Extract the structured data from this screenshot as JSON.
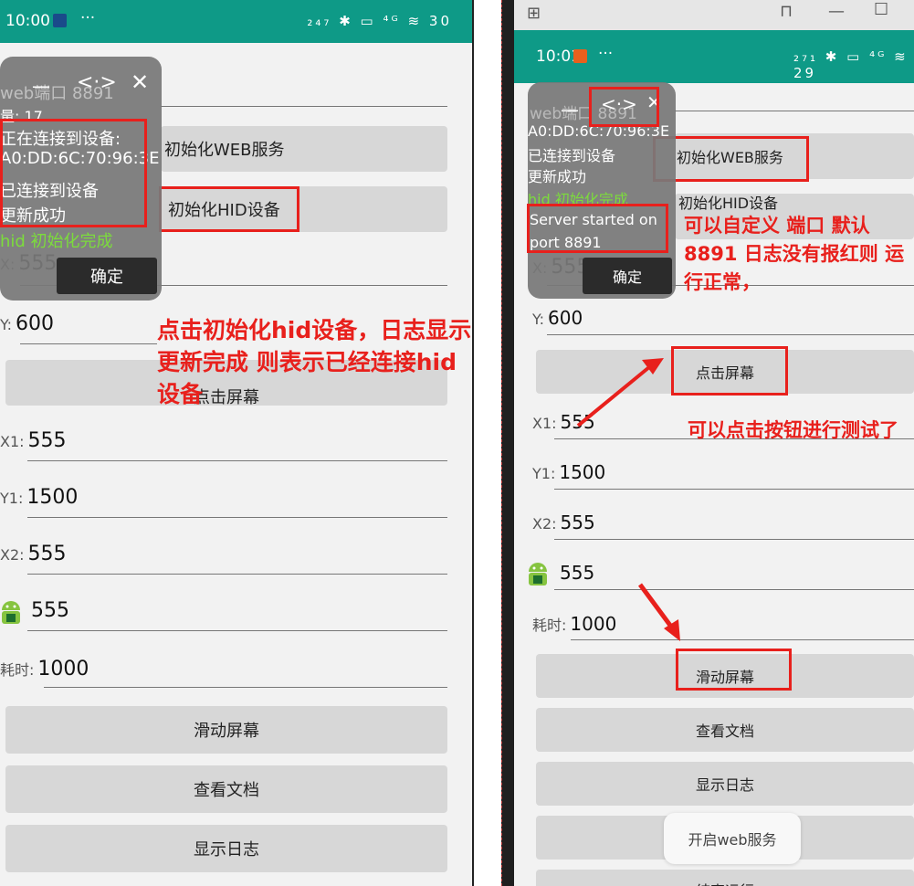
{
  "left": {
    "status": {
      "time": "10:00",
      "icons": "₂₄₇ ✱ ▭ ⁴ᴳ ≋ 30"
    },
    "overlay": {
      "titlebar": {
        "minimize": "—",
        "code": "<·>",
        "close": "✕"
      },
      "lines": [
        "web端口 8891",
        "量: 17",
        "正在连接到设备:",
        "A0:DD:6C:70:96:3E",
        "已连接到设备",
        "更新成功",
        "hid 初始化完成"
      ],
      "ok_label": "确定"
    },
    "fields": {
      "x": {
        "label": "X:",
        "value": "555"
      },
      "y": {
        "label": "Y:",
        "value": "600"
      },
      "x1": {
        "label": "X1:",
        "value": "555"
      },
      "y1": {
        "label": "Y1:",
        "value": "1500"
      },
      "x2": {
        "label": "X2:",
        "value": "555"
      },
      "y2": {
        "value": "555"
      },
      "duration": {
        "label": "耗时:",
        "value": "1000"
      }
    },
    "buttons": {
      "init_web": "初始化WEB服务",
      "init_hid": "初始化HID设备",
      "tap": "点击屏幕",
      "swipe": "滑动屏幕",
      "docs": "查看文档",
      "logs": "显示日志"
    },
    "annotation": "点击初始化hid设备，日志显示 更新完成 则表示已经连接hid设备"
  },
  "right": {
    "window_controls": {
      "new_tab": "⊞",
      "pin": "⊓",
      "minimize": "—",
      "maximize": "☐"
    },
    "status": {
      "time": "10:01",
      "icons": "₂₇₁ ✱ ▭ ⁴ᴳ ≋ 29"
    },
    "overlay": {
      "titlebar": {
        "minimize": "—",
        "code": "<·>",
        "close": "✕"
      },
      "lines": [
        "web端口 8891",
        "A0:DD:6C:70:96:3E",
        "已连接到设备",
        "更新成功",
        "hid 初始化完成",
        "Server started on",
        "port 8891"
      ],
      "ok_label": "确定"
    },
    "fields": {
      "x": {
        "label": "X:",
        "value": "555"
      },
      "y": {
        "label": "Y:",
        "value": "600"
      },
      "x1": {
        "label": "X1:",
        "value": "555"
      },
      "y1": {
        "label": "Y1:",
        "value": "1500"
      },
      "x2": {
        "label": "X2:",
        "value": "555"
      },
      "y2": {
        "value": "555"
      },
      "duration": {
        "label": "耗时:",
        "value": "1000"
      }
    },
    "buttons": {
      "init_web": "初始化WEB服务",
      "init_hid": "初始化HID设备",
      "tap": "点击屏幕",
      "swipe": "滑动屏幕",
      "docs": "查看文档",
      "logs": "显示日志",
      "stop": "结束运行"
    },
    "toast": "开启web服务",
    "annotation1": "可以自定义 端口 默认8891  日志没有报红则 运行正常，",
    "annotation2": "可以点击按钮进行测试了"
  },
  "colors": {
    "status_bar": "#0e9a87",
    "annotation_red": "#e8201c",
    "hid_green": "#7cdc3c"
  }
}
